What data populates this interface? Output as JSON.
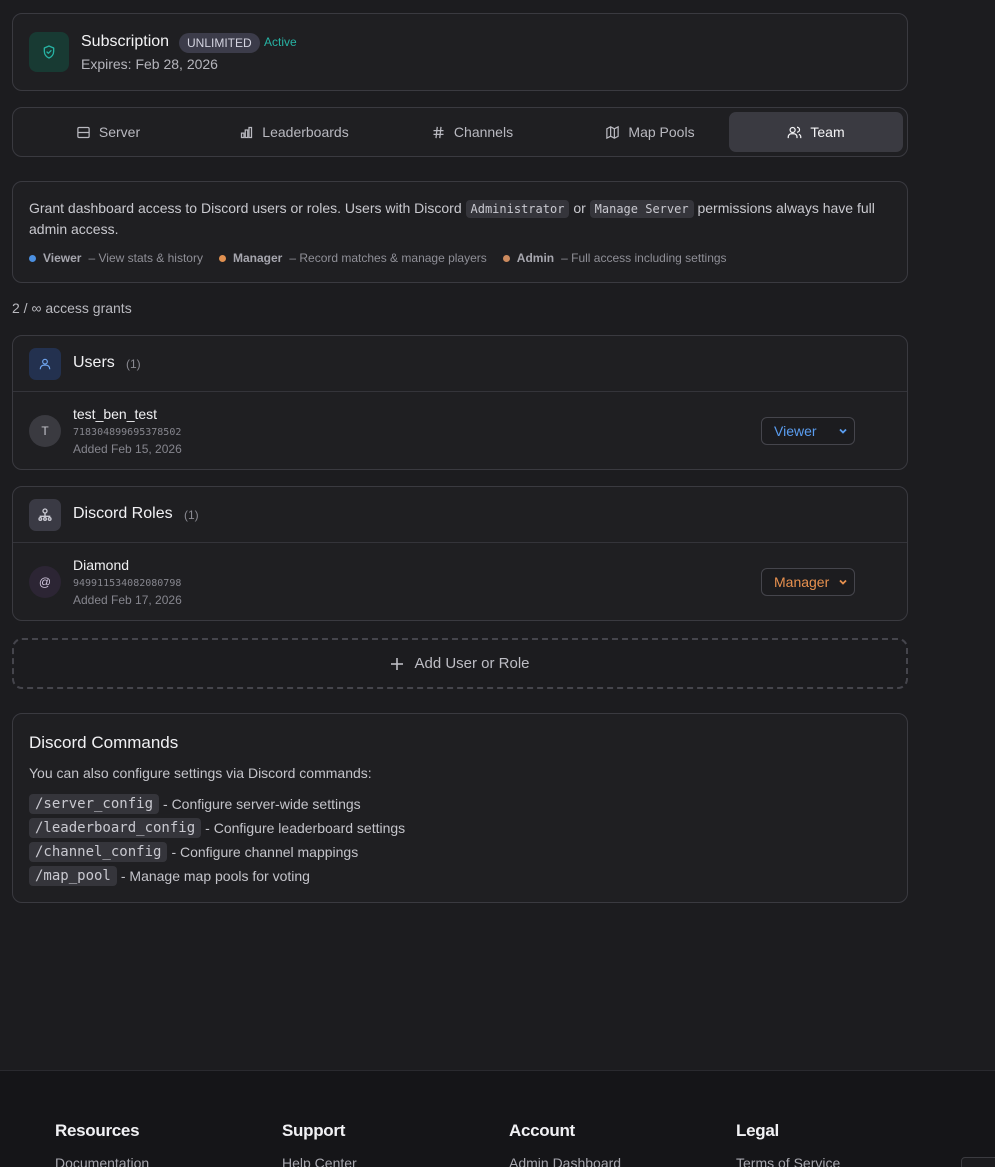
{
  "subscription": {
    "title": "Subscription",
    "badge": "UNLIMITED",
    "status": "Active",
    "expires": "Expires: Feb 28, 2026"
  },
  "tabs": [
    {
      "label": "Server",
      "icon": "server-icon"
    },
    {
      "label": "Leaderboards",
      "icon": "bar-chart-icon"
    },
    {
      "label": "Channels",
      "icon": "hash-icon"
    },
    {
      "label": "Map Pools",
      "icon": "map-icon"
    },
    {
      "label": "Team",
      "icon": "users-icon",
      "selected": true
    }
  ],
  "info": {
    "text_before": "Grant dashboard access to Discord users or roles. Users with Discord",
    "code_admin": "Administrator",
    "text_or": "or",
    "code_manage": "Manage Server",
    "text_after": "permissions always have full admin access.",
    "roles": [
      {
        "name": "Viewer",
        "desc": "– View stats & history",
        "color": "#4b8fe0"
      },
      {
        "name": "Manager",
        "desc": "– Record matches & manage players",
        "color": "#e09050"
      },
      {
        "name": "Admin",
        "desc": "– Full access including settings",
        "color": "#cc8a5e"
      }
    ]
  },
  "grants_count": "2 / ∞ access grants",
  "users": {
    "title": "Users",
    "count": "(1)",
    "rows": [
      {
        "avatar": "T",
        "name": "test_ben_test",
        "id": "718304899695378502",
        "added": "Added Feb 15, 2026",
        "role": "Viewer",
        "role_color": "#5a9df0"
      }
    ]
  },
  "roles": {
    "title": "Discord Roles",
    "count": "(1)",
    "rows": [
      {
        "avatar": "@",
        "name": "Diamond",
        "id": "949911534082080798",
        "added": "Added Feb 17, 2026",
        "role": "Manager",
        "role_color": "#e8914f"
      }
    ]
  },
  "add_button": "Add User or Role",
  "commands": {
    "title": "Discord Commands",
    "intro": "You can also configure settings via Discord commands:",
    "items": [
      {
        "cmd": "/server_config",
        "desc": "- Configure server-wide settings"
      },
      {
        "cmd": "/leaderboard_config",
        "desc": "- Configure leaderboard settings"
      },
      {
        "cmd": "/channel_config",
        "desc": "- Configure channel mappings"
      },
      {
        "cmd": "/map_pool",
        "desc": "- Manage map pools for voting"
      }
    ]
  },
  "footer": {
    "columns": [
      {
        "heading": "Resources",
        "first_link": "Documentation"
      },
      {
        "heading": "Support",
        "first_link": "Help Center"
      },
      {
        "heading": "Account",
        "first_link": "Admin Dashboard"
      },
      {
        "heading": "Legal",
        "first_link": "Terms of Service"
      }
    ]
  }
}
